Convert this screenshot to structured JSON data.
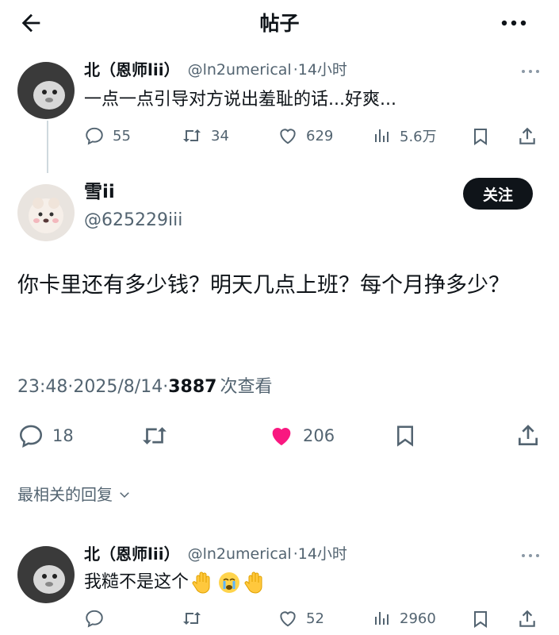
{
  "header": {
    "title": "帖子",
    "back_icon": "arrow-left-icon",
    "more_icon": "more-horizontal-icon"
  },
  "parent_tweet": {
    "name": "北（恩师lii）",
    "handle": "@ln2umerical",
    "time": "·14小时",
    "text": "一点一点引导对方说出羞耻的话...好爽...",
    "stats": {
      "replies": "55",
      "retweets": "34",
      "likes": "629",
      "views": "5.6万"
    }
  },
  "main_tweet": {
    "name": "雪ii",
    "handle": "@625229iii",
    "follow_label": "关注",
    "text": "你卡里还有多少钱？明天几点上班？每个月挣多少？",
    "time": "23:48",
    "date": "·2025/8/14·",
    "views_count": "3887",
    "views_label": "次查看",
    "stats": {
      "replies": "18",
      "likes": "206"
    },
    "colors": {
      "liked": "#f91880"
    }
  },
  "replies_section": {
    "sort_label": "最相关的回复"
  },
  "reply": {
    "name": "北（恩师lii）",
    "handle": "@ln2umerical",
    "time": "·14小时",
    "text": "我糙不是这个",
    "stats": {
      "likes": "52",
      "views": "2960"
    }
  }
}
